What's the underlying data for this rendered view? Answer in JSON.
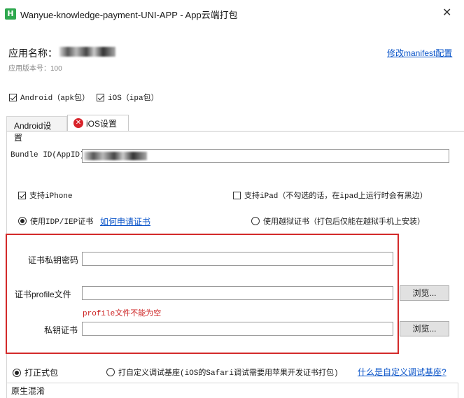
{
  "window": {
    "title": "Wanyue-knowledge-payment-UNI-APP - App云端打包",
    "logo_letter": "H",
    "close_glyph": "✕"
  },
  "app": {
    "name_label": "应用名称：",
    "version": "应用版本号：100",
    "manifest_link": "修改manifest配置"
  },
  "platforms": {
    "android": {
      "label": "Android（apk包）",
      "checked": true
    },
    "ios": {
      "label": "iOS（ipa包）",
      "checked": true
    }
  },
  "tabs": [
    {
      "label": "Android设置",
      "active": false
    },
    {
      "label": "iOS设置",
      "active": true,
      "has_error": true
    }
  ],
  "ios": {
    "bundle_id_label": "Bundle ID(AppID)",
    "bundle_id_value": "",
    "support_iphone": {
      "label": "支持iPhone",
      "checked": true
    },
    "support_ipad": {
      "label": "支持iPad（不勾选的话，在ipad上运行时会有黑边）",
      "checked": false
    },
    "cert_type_idp": {
      "label": "使用IDP/IEP证书",
      "checked": true
    },
    "cert_help_link": "如何申请证书",
    "cert_type_jailbreak": {
      "label": "使用越狱证书（打包后仅能在越狱手机上安装）",
      "checked": false
    },
    "cert_password_label": "证书私钥密码",
    "cert_password_value": "",
    "profile_label": "证书profile文件",
    "profile_value": "",
    "profile_error": "profile文件不能为空",
    "private_key_label": "私钥证书",
    "private_key_value": "",
    "browse_label": "浏览..."
  },
  "package": {
    "release": {
      "label": "打正式包",
      "checked": true
    },
    "custom_base": {
      "label": "打自定义调试基座(iOS的Safari调试需要用苹果开发证书打包)",
      "checked": false
    },
    "custom_base_link": "什么是自定义调试基座?"
  },
  "obfuscation": {
    "label": "原生混淆"
  },
  "colors": {
    "error_border": "#d32a2a",
    "link": "#0b55c9",
    "logo": "#2fa84f"
  }
}
